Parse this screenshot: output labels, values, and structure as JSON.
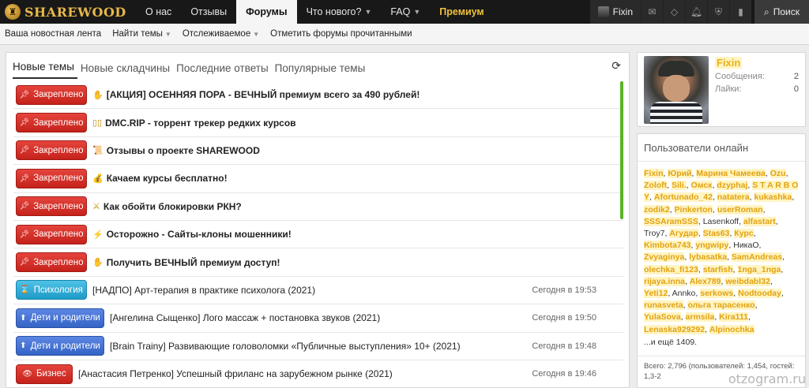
{
  "nav": {
    "logo_text": "SHAREWOOD",
    "tabs": [
      {
        "label": "О нас",
        "active": false,
        "caret": false
      },
      {
        "label": "Отзывы",
        "active": false,
        "caret": false
      },
      {
        "label": "Форумы",
        "active": true,
        "caret": false
      },
      {
        "label": "Что нового?",
        "active": false,
        "caret": true
      },
      {
        "label": "FAQ",
        "active": false,
        "caret": true
      }
    ],
    "premium": "Премиум",
    "user": "Fixin",
    "search": "Поиск"
  },
  "subnav": [
    "Ваша новостная лента",
    "Найти темы",
    "Отслеживаемое",
    "Отметить форумы прочитанными"
  ],
  "tabs": [
    "Новые темы",
    "Новые складчины",
    "Последние ответы",
    "Популярные темы"
  ],
  "threads": [
    {
      "badge": "Закреплено",
      "type": "red",
      "prefix": "✋",
      "title": "[АКЦИЯ] ОСЕННЯЯ ПОРА - ВЕЧНЫЙ премиум всего за 490 рублей!",
      "sticky": true,
      "time": ""
    },
    {
      "badge": "Закреплено",
      "type": "red",
      "prefix": "▯▯",
      "title": "DMC.RIP - торрент трекер редких курсов",
      "sticky": true,
      "time": ""
    },
    {
      "badge": "Закреплено",
      "type": "red",
      "prefix": "📜",
      "title": "Отзывы о проекте SHAREWOOD",
      "sticky": true,
      "time": ""
    },
    {
      "badge": "Закреплено",
      "type": "red",
      "prefix": "💰",
      "title": "Качаем курсы бесплатно!",
      "sticky": true,
      "time": ""
    },
    {
      "badge": "Закреплено",
      "type": "red",
      "prefix": "⚔",
      "title": "Как обойти блокировки РКН?",
      "sticky": true,
      "time": ""
    },
    {
      "badge": "Закреплено",
      "type": "red",
      "prefix": "⚡",
      "title": "Осторожно - Сайты-клоны мошенники!",
      "sticky": true,
      "time": ""
    },
    {
      "badge": "Закреплено",
      "type": "red",
      "prefix": "✋",
      "title": "Получить ВЕЧНЫЙ премиум доступ!",
      "sticky": true,
      "time": ""
    },
    {
      "badge": "Психология",
      "type": "cyan",
      "prefix": "",
      "title": "[НАДПО] Арт-терапия в практике психолога (2021)",
      "sticky": false,
      "time": "Сегодня в 19:53"
    },
    {
      "badge": "Дети и родители",
      "type": "blue",
      "prefix": "",
      "title": "[Ангелина Сыщенко] Лого массаж + постановка звуков (2021)",
      "sticky": false,
      "time": "Сегодня в 19:50"
    },
    {
      "badge": "Дети и родители",
      "type": "blue",
      "prefix": "",
      "title": "[Brain Trainy] Развивающие головоломки «Публичные выступления» 10+ (2021)",
      "sticky": false,
      "time": "Сегодня в 19:48"
    },
    {
      "badge": "Бизнес",
      "type": "biz",
      "prefix": "",
      "title": "[Анастасия Петренко] Успешный фриланс на зарубежном рынке (2021)",
      "sticky": false,
      "time": "Сегодня в 19:46"
    }
  ],
  "profile": {
    "name": "Fixin",
    "messages_label": "Сообщения:",
    "messages": "2",
    "likes_label": "Лайки:",
    "likes": "0"
  },
  "online": {
    "title": "Пользователи онлайн",
    "users": [
      {
        "n": "Fixin",
        "h": true
      },
      {
        "n": "Юрий",
        "h": true
      },
      {
        "n": "Марина Чамеева",
        "h": true
      },
      {
        "n": "Ozu",
        "h": true
      },
      {
        "n": "Zoloft",
        "h": true
      },
      {
        "n": "Sili.",
        "h": true
      },
      {
        "n": "Омск",
        "h": true
      },
      {
        "n": "dzyphaj",
        "h": true
      },
      {
        "n": "S T A R B O Y",
        "h": true
      },
      {
        "n": "Afortunado_42",
        "h": true
      },
      {
        "n": "natatera",
        "h": true
      },
      {
        "n": "kukashka",
        "h": true
      },
      {
        "n": "zodik2",
        "h": true
      },
      {
        "n": "Pinkerton",
        "h": true
      },
      {
        "n": "userRoman",
        "h": true
      },
      {
        "n": "SSSAramSSS",
        "h": true
      },
      {
        "n": "Lasenkoff",
        "h": false
      },
      {
        "n": "alfastart",
        "h": true
      },
      {
        "n": "Troy7",
        "h": false
      },
      {
        "n": "Агудар",
        "h": true
      },
      {
        "n": "Stas63",
        "h": true
      },
      {
        "n": "Курс",
        "h": true
      },
      {
        "n": "Kimbota743",
        "h": true
      },
      {
        "n": "yngwipy",
        "h": true
      },
      {
        "n": "НикаО",
        "h": false
      },
      {
        "n": "Zvyaginya",
        "h": true
      },
      {
        "n": "lybasatka",
        "h": true
      },
      {
        "n": "SamAndreas",
        "h": true
      },
      {
        "n": "olechka_fi123",
        "h": true
      },
      {
        "n": "starfish",
        "h": true
      },
      {
        "n": "1nga_1nga",
        "h": true
      },
      {
        "n": "rijaya.inna",
        "h": true
      },
      {
        "n": "Alex789",
        "h": true
      },
      {
        "n": "weibdabl32",
        "h": true
      },
      {
        "n": "Yeti12",
        "h": true
      },
      {
        "n": "Annko",
        "h": false
      },
      {
        "n": "serkows",
        "h": true
      },
      {
        "n": "Nodtooday",
        "h": true
      },
      {
        "n": "runasveta",
        "h": true
      },
      {
        "n": "ольга тарасенко",
        "h": true
      },
      {
        "n": "YulaSova",
        "h": true
      },
      {
        "n": "armsila",
        "h": true
      },
      {
        "n": "Kira111",
        "h": true
      },
      {
        "n": "Lenaska929292",
        "h": true
      },
      {
        "n": "Alpinochka",
        "h": true
      }
    ],
    "more": "...и ещё 1409.",
    "total": "Всего: 2,796 (пользователей: 1,454, гостей: 1,3-2"
  },
  "watermark": "otzogram.ru"
}
